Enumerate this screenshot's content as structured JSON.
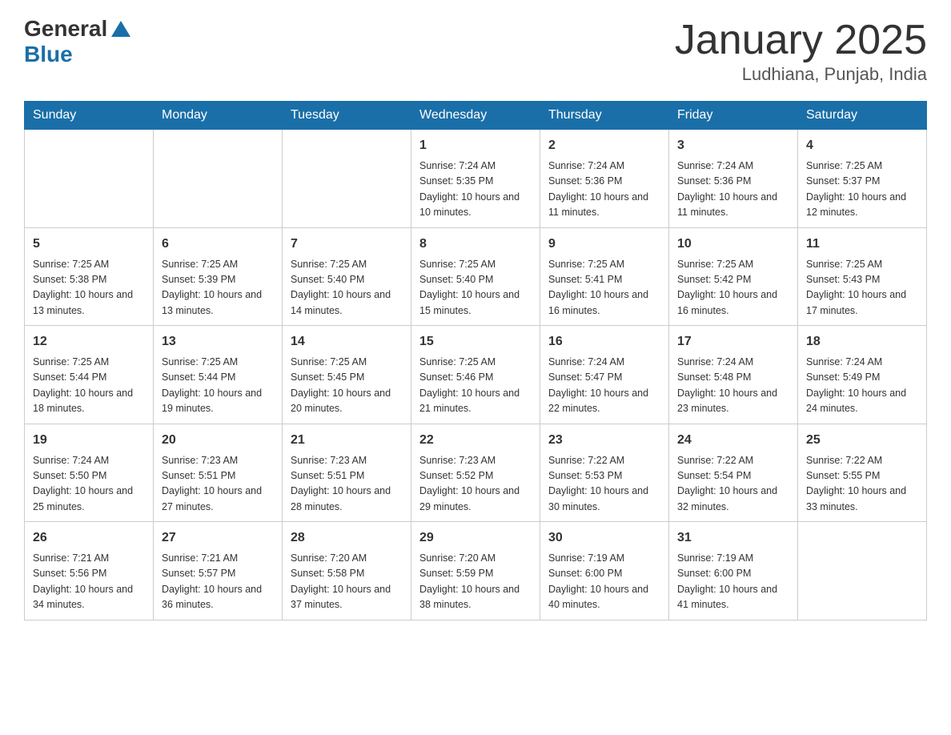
{
  "header": {
    "logo_general": "General",
    "logo_blue": "Blue",
    "title": "January 2025",
    "subtitle": "Ludhiana, Punjab, India"
  },
  "days_of_week": [
    "Sunday",
    "Monday",
    "Tuesday",
    "Wednesday",
    "Thursday",
    "Friday",
    "Saturday"
  ],
  "weeks": [
    [
      {
        "day": "",
        "info": ""
      },
      {
        "day": "",
        "info": ""
      },
      {
        "day": "",
        "info": ""
      },
      {
        "day": "1",
        "info": "Sunrise: 7:24 AM\nSunset: 5:35 PM\nDaylight: 10 hours\nand 10 minutes."
      },
      {
        "day": "2",
        "info": "Sunrise: 7:24 AM\nSunset: 5:36 PM\nDaylight: 10 hours\nand 11 minutes."
      },
      {
        "day": "3",
        "info": "Sunrise: 7:24 AM\nSunset: 5:36 PM\nDaylight: 10 hours\nand 11 minutes."
      },
      {
        "day": "4",
        "info": "Sunrise: 7:25 AM\nSunset: 5:37 PM\nDaylight: 10 hours\nand 12 minutes."
      }
    ],
    [
      {
        "day": "5",
        "info": "Sunrise: 7:25 AM\nSunset: 5:38 PM\nDaylight: 10 hours\nand 13 minutes."
      },
      {
        "day": "6",
        "info": "Sunrise: 7:25 AM\nSunset: 5:39 PM\nDaylight: 10 hours\nand 13 minutes."
      },
      {
        "day": "7",
        "info": "Sunrise: 7:25 AM\nSunset: 5:40 PM\nDaylight: 10 hours\nand 14 minutes."
      },
      {
        "day": "8",
        "info": "Sunrise: 7:25 AM\nSunset: 5:40 PM\nDaylight: 10 hours\nand 15 minutes."
      },
      {
        "day": "9",
        "info": "Sunrise: 7:25 AM\nSunset: 5:41 PM\nDaylight: 10 hours\nand 16 minutes."
      },
      {
        "day": "10",
        "info": "Sunrise: 7:25 AM\nSunset: 5:42 PM\nDaylight: 10 hours\nand 16 minutes."
      },
      {
        "day": "11",
        "info": "Sunrise: 7:25 AM\nSunset: 5:43 PM\nDaylight: 10 hours\nand 17 minutes."
      }
    ],
    [
      {
        "day": "12",
        "info": "Sunrise: 7:25 AM\nSunset: 5:44 PM\nDaylight: 10 hours\nand 18 minutes."
      },
      {
        "day": "13",
        "info": "Sunrise: 7:25 AM\nSunset: 5:44 PM\nDaylight: 10 hours\nand 19 minutes."
      },
      {
        "day": "14",
        "info": "Sunrise: 7:25 AM\nSunset: 5:45 PM\nDaylight: 10 hours\nand 20 minutes."
      },
      {
        "day": "15",
        "info": "Sunrise: 7:25 AM\nSunset: 5:46 PM\nDaylight: 10 hours\nand 21 minutes."
      },
      {
        "day": "16",
        "info": "Sunrise: 7:24 AM\nSunset: 5:47 PM\nDaylight: 10 hours\nand 22 minutes."
      },
      {
        "day": "17",
        "info": "Sunrise: 7:24 AM\nSunset: 5:48 PM\nDaylight: 10 hours\nand 23 minutes."
      },
      {
        "day": "18",
        "info": "Sunrise: 7:24 AM\nSunset: 5:49 PM\nDaylight: 10 hours\nand 24 minutes."
      }
    ],
    [
      {
        "day": "19",
        "info": "Sunrise: 7:24 AM\nSunset: 5:50 PM\nDaylight: 10 hours\nand 25 minutes."
      },
      {
        "day": "20",
        "info": "Sunrise: 7:23 AM\nSunset: 5:51 PM\nDaylight: 10 hours\nand 27 minutes."
      },
      {
        "day": "21",
        "info": "Sunrise: 7:23 AM\nSunset: 5:51 PM\nDaylight: 10 hours\nand 28 minutes."
      },
      {
        "day": "22",
        "info": "Sunrise: 7:23 AM\nSunset: 5:52 PM\nDaylight: 10 hours\nand 29 minutes."
      },
      {
        "day": "23",
        "info": "Sunrise: 7:22 AM\nSunset: 5:53 PM\nDaylight: 10 hours\nand 30 minutes."
      },
      {
        "day": "24",
        "info": "Sunrise: 7:22 AM\nSunset: 5:54 PM\nDaylight: 10 hours\nand 32 minutes."
      },
      {
        "day": "25",
        "info": "Sunrise: 7:22 AM\nSunset: 5:55 PM\nDaylight: 10 hours\nand 33 minutes."
      }
    ],
    [
      {
        "day": "26",
        "info": "Sunrise: 7:21 AM\nSunset: 5:56 PM\nDaylight: 10 hours\nand 34 minutes."
      },
      {
        "day": "27",
        "info": "Sunrise: 7:21 AM\nSunset: 5:57 PM\nDaylight: 10 hours\nand 36 minutes."
      },
      {
        "day": "28",
        "info": "Sunrise: 7:20 AM\nSunset: 5:58 PM\nDaylight: 10 hours\nand 37 minutes."
      },
      {
        "day": "29",
        "info": "Sunrise: 7:20 AM\nSunset: 5:59 PM\nDaylight: 10 hours\nand 38 minutes."
      },
      {
        "day": "30",
        "info": "Sunrise: 7:19 AM\nSunset: 6:00 PM\nDaylight: 10 hours\nand 40 minutes."
      },
      {
        "day": "31",
        "info": "Sunrise: 7:19 AM\nSunset: 6:00 PM\nDaylight: 10 hours\nand 41 minutes."
      },
      {
        "day": "",
        "info": ""
      }
    ]
  ]
}
